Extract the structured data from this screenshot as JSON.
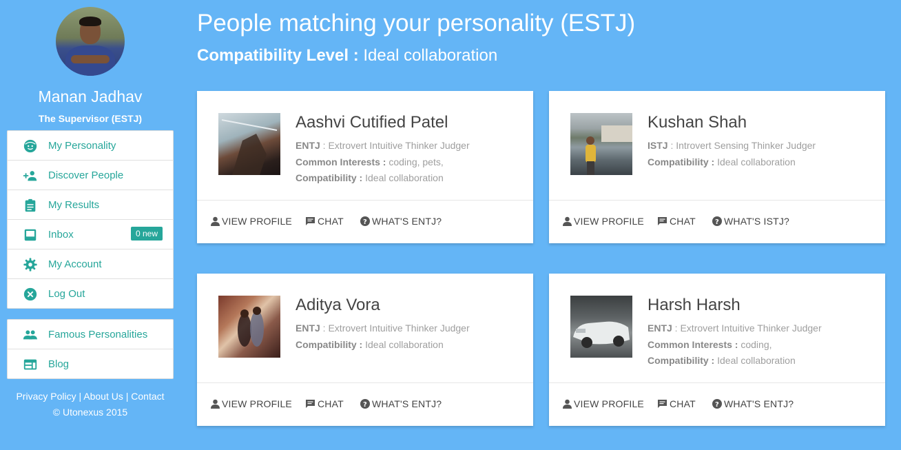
{
  "user": {
    "name": "Manan Jadhav",
    "type": "The Supervisor (ESTJ)"
  },
  "menu": [
    {
      "label": "My Personality",
      "icon": "face-icon"
    },
    {
      "label": "Discover People",
      "icon": "group-add-icon"
    },
    {
      "label": "My Results",
      "icon": "clipboard-icon"
    },
    {
      "label": "Inbox",
      "icon": "inbox-icon",
      "badge": "0 new"
    },
    {
      "label": "My Account",
      "icon": "gear-icon"
    },
    {
      "label": "Log Out",
      "icon": "cancel-icon"
    }
  ],
  "menu2": [
    {
      "label": "Famous Personalities",
      "icon": "people-icon"
    },
    {
      "label": "Blog",
      "icon": "web-icon"
    }
  ],
  "footer": {
    "privacy": "Privacy Policy",
    "sep1": " | ",
    "about": "About Us",
    "sep2": " | ",
    "contact": "Contact",
    "copyright": "© Utonexus 2015"
  },
  "main": {
    "title": "People matching your personality (ESTJ)",
    "compat_label": "Compatibility Level :",
    "compat_value": " Ideal collaboration"
  },
  "cards": [
    {
      "name": "Aashvi Cutified Patel",
      "type_code": "ENTJ",
      "type_desc": " : Extrovert Intuitive Thinker Judger",
      "interests_label": "Common Interests :",
      "interests": " coding, pets,",
      "compat_label": "Compatibility :",
      "compat_value": " Ideal collaboration",
      "view": "VIEW PROFILE",
      "chat": "CHAT",
      "whats": "WHAT'S ENTJ?"
    },
    {
      "name": "Kushan Shah",
      "type_code": "ISTJ",
      "type_desc": " : Introvert Sensing Thinker Judger",
      "compat_label": "Compatibility :",
      "compat_value": " Ideal collaboration",
      "view": "VIEW PROFILE",
      "chat": "CHAT",
      "whats": "WHAT'S ISTJ?"
    },
    {
      "name": "Aditya Vora",
      "type_code": "ENTJ",
      "type_desc": " : Extrovert Intuitive Thinker Judger",
      "compat_label": "Compatibility :",
      "compat_value": " Ideal collaboration",
      "view": "VIEW PROFILE",
      "chat": "CHAT",
      "whats": "WHAT'S ENTJ?"
    },
    {
      "name": "Harsh Harsh",
      "type_code": "ENTJ",
      "type_desc": " : Extrovert Intuitive Thinker Judger",
      "interests_label": "Common Interests :",
      "interests": " coding,",
      "compat_label": "Compatibility :",
      "compat_value": " Ideal collaboration",
      "view": "VIEW PROFILE",
      "chat": "CHAT",
      "whats": "WHAT'S ENTJ?"
    }
  ],
  "colors": {
    "background": "#64b5f6",
    "accent": "#26a69a",
    "card": "#ffffff"
  }
}
